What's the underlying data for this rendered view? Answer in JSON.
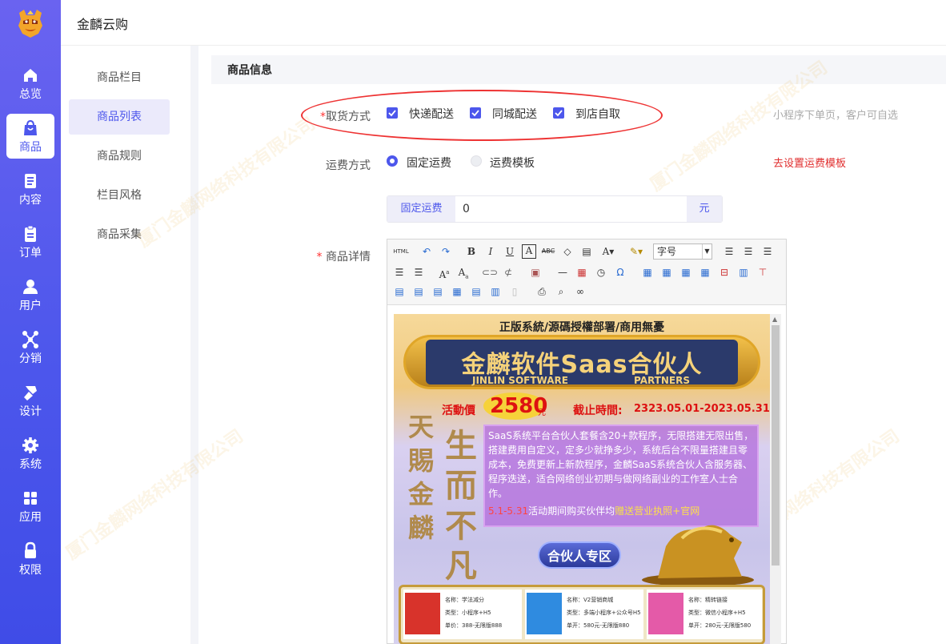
{
  "app": {
    "title": "金麟云购"
  },
  "nav": [
    {
      "label": "总览",
      "icon": "home-icon"
    },
    {
      "label": "商品",
      "icon": "bag-icon",
      "active": true
    },
    {
      "label": "内容",
      "icon": "document-icon"
    },
    {
      "label": "订单",
      "icon": "clipboard-icon"
    },
    {
      "label": "用户",
      "icon": "user-icon"
    },
    {
      "label": "分销",
      "icon": "network-icon"
    },
    {
      "label": "设计",
      "icon": "brush-icon"
    },
    {
      "label": "系统",
      "icon": "gear-icon"
    },
    {
      "label": "应用",
      "icon": "grid-icon"
    },
    {
      "label": "权限",
      "icon": "lock-icon"
    }
  ],
  "subnav": [
    {
      "label": "商品栏目"
    },
    {
      "label": "商品列表",
      "active": true
    },
    {
      "label": "商品规则"
    },
    {
      "label": "栏目风格"
    },
    {
      "label": "商品采集"
    }
  ],
  "section": {
    "title": "商品信息"
  },
  "pickup": {
    "label": "取货方式",
    "required": "*",
    "options": [
      {
        "label": "快递配送",
        "checked": true
      },
      {
        "label": "同城配送",
        "checked": true
      },
      {
        "label": "到店自取",
        "checked": true
      }
    ],
    "hint": "小程序下单页，客户可自选"
  },
  "shipping": {
    "label": "运费方式",
    "options": [
      {
        "label": "固定运费",
        "selected": true
      },
      {
        "label": "运费模板",
        "selected": false
      }
    ],
    "link": "去设置运费模板"
  },
  "fixed_fee": {
    "prefix": "固定运费",
    "value": "0",
    "suffix": "元"
  },
  "detail": {
    "label": "商品详情",
    "required": "*"
  },
  "editor": {
    "font_size_placeholder": "字号",
    "html_label": "HTML",
    "poster": {
      "top_banner": "正版系統/源碼授權部署/商用無憂",
      "brand": "金麟软件Saas合伙人",
      "brand_en_left": "JINLIN SOFTWARE",
      "brand_en_right": "PARTNERS",
      "price_label": "活動價",
      "price": "2580",
      "price_unit": "元",
      "deadline_label": "截止時間:",
      "deadline": "2323.05.01-2023.05.31",
      "calligraphy_left": "天賜金麟",
      "calligraphy_right": "生而不凡",
      "description": "SaaS系统平台合伙人套餐含20+款程序，无限搭建无限出售，搭建费用自定义，定多少就挣多少，系统后台不限量搭建且零成本，免费更新上新款程序，金麟SaaS系统合伙人含服务器、程序迭送，适合网络创业初期与做网络副业的工作室人士合作。",
      "promo_date": "5.1-5.31",
      "promo_text": "活动期间购买伙伴均",
      "promo_gift": "赠送",
      "promo_items": "营业执照+官网",
      "zone_button": "合伙人专区",
      "products": [
        {
          "name": "名称：学法减分",
          "type": "类型：小程序+H5",
          "price": "单价：388-无限版888"
        },
        {
          "name": "名称：V2营销商城",
          "type": "类型：多端小程序+公众号H5",
          "price": "单开：580元-无限版880"
        },
        {
          "name": "名称：精转链接",
          "type": "类型：微信小程序+H5",
          "price": "单开：280元-无限版580"
        }
      ]
    }
  },
  "watermark": "厦门金麟网络科技有限公司",
  "colors": {
    "primary": "#4d57ec",
    "danger": "#e02c2c",
    "annotation": "#e33333"
  }
}
